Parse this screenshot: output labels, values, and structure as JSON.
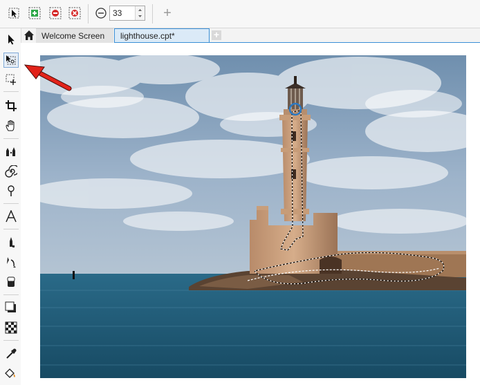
{
  "toolbar": {
    "buttons": [
      {
        "name": "selection-tool-button",
        "icon": "pointer-icon"
      },
      {
        "name": "add-mask-button",
        "icon": "plus-mask-icon"
      },
      {
        "name": "subtract-mask-button",
        "icon": "minus-mask-icon"
      },
      {
        "name": "remove-mask-button",
        "icon": "remove-mask-icon"
      },
      {
        "name": "feather-button",
        "icon": "minus-circle-icon"
      }
    ],
    "value": "33",
    "add_label": "+"
  },
  "tabs": [
    {
      "label": "Welcome Screen",
      "active": false
    },
    {
      "label": "lighthouse.cpt*",
      "active": true
    }
  ],
  "new_tab_label": "+",
  "toolbox": [
    "pick-tool-icon",
    "mask-transform-tool-icon",
    "rectangle-mask-tool-icon",
    "crop-tool-icon",
    "pan-tool-icon",
    "effect-tool-icon",
    "liquid-swirl-tool-icon",
    "liquid-tool-icon",
    "text-tool-icon",
    "paint-tool-icon",
    "clone-tool-icon",
    "eraser-tool-icon",
    "shadow-tool-icon",
    "transparency-tool-icon",
    "eyedropper-tool-icon",
    "fill-tool-icon"
  ],
  "colors": {
    "accent": "#3a8fd6",
    "arrow": "#e2231a",
    "sky": "#8fa9c4",
    "sea": "#1f5a78"
  }
}
